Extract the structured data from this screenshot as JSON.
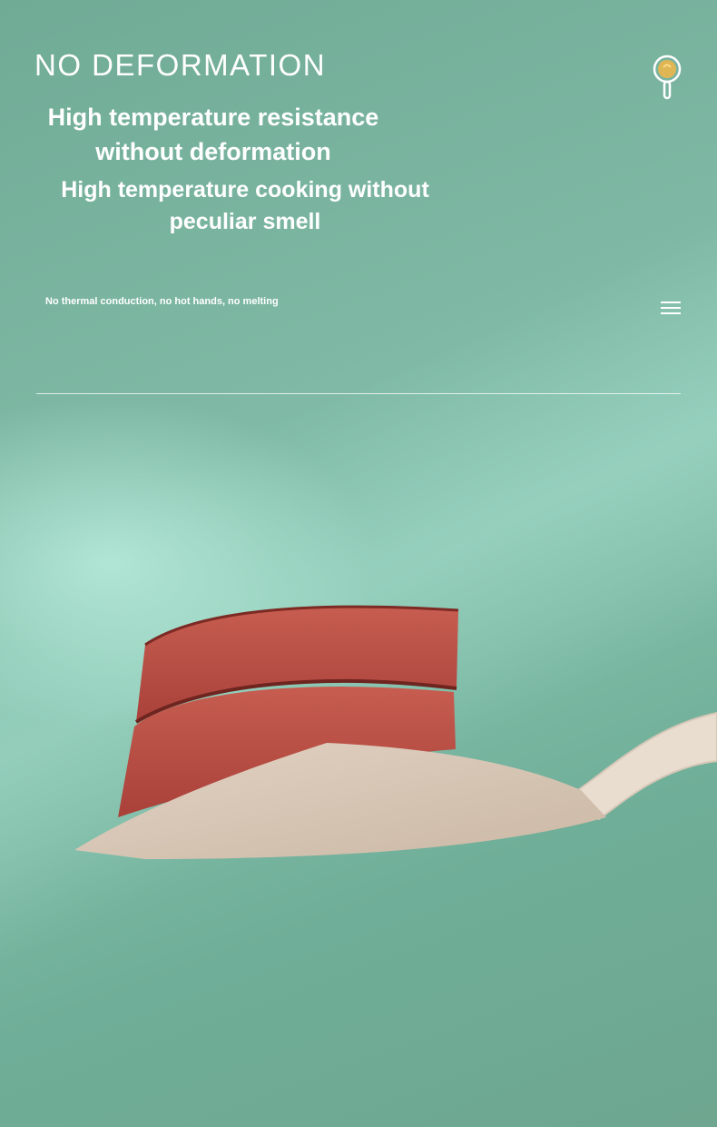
{
  "header": {
    "title": "NO DEFORMATION",
    "logo_icon": "frying-pan-logo-icon",
    "menu_icon": "hamburger-menu-icon"
  },
  "content": {
    "headline_1": "High temperature resistance\nwithout deformation",
    "headline_2": "High temperature cooking without\npeculiar smell",
    "subtext": "No thermal conduction, no hot hands, no melting"
  },
  "product_image": {
    "icon": "spatula-with-meat-slices-illustration"
  },
  "colors": {
    "background": "#72ac98",
    "text": "#ffffff",
    "spatula": "#d8c6b4",
    "meat": "#b54a3e",
    "logo_accent": "#e0b654"
  }
}
